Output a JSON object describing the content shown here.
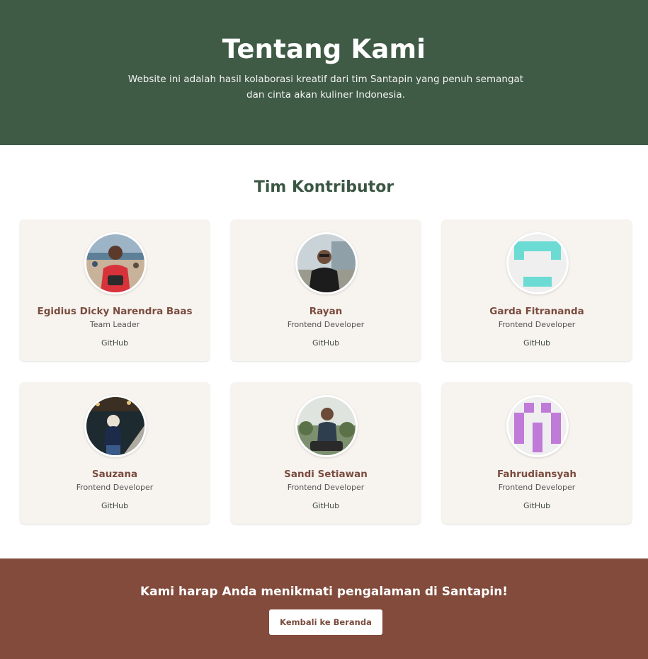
{
  "hero": {
    "title": "Tentang Kami",
    "subtitle": "Website ini adalah hasil kolaborasi kreatif dari tim Santapin yang penuh semangat dan cinta akan kuliner Indonesia."
  },
  "team": {
    "title": "Tim Kontributor",
    "members": [
      {
        "name": "Egidius Dicky Narendra Baas",
        "role": "Team Leader",
        "link": "GitHub",
        "avatar": "photo"
      },
      {
        "name": "Rayan",
        "role": "Frontend Developer",
        "link": "GitHub",
        "avatar": "photo"
      },
      {
        "name": "Garda Fitrananda",
        "role": "Frontend Developer",
        "link": "GitHub",
        "avatar": "identicon"
      },
      {
        "name": "Sauzana",
        "role": "Frontend Developer",
        "link": "GitHub",
        "avatar": "photo"
      },
      {
        "name": "Sandi Setiawan",
        "role": "Frontend Developer",
        "link": "GitHub",
        "avatar": "photo"
      },
      {
        "name": "Fahrudiansyah",
        "role": "Frontend Developer",
        "link": "GitHub",
        "avatar": "identicon"
      }
    ]
  },
  "footer": {
    "message": "Kami harap Anda menikmati pengalaman di Santapin!",
    "button_label": "Kembali ke Beranda"
  },
  "colors": {
    "hero_bg": "#3f5a45",
    "footer_bg": "#834b3c",
    "card_bg": "#f7f3ef",
    "name_text": "#7a4c3e",
    "identicon_teal": "#6bdbd3",
    "identicon_purple": "#c07ad8"
  }
}
